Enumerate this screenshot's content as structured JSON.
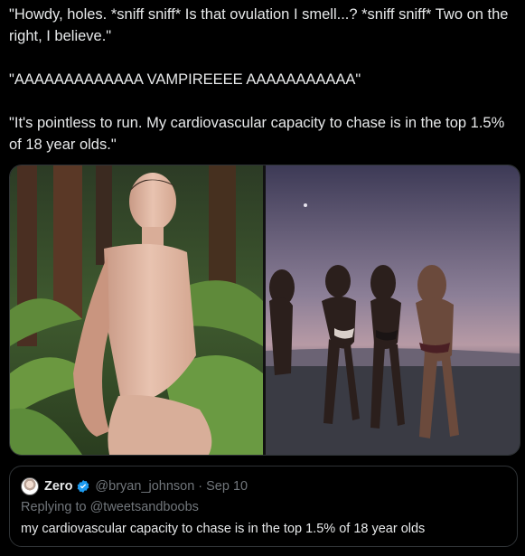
{
  "tweet": {
    "paragraphs": [
      "\"Howdy, holes. *sniff sniff* Is that ovulation I smell...? *sniff sniff* Two on the right, I believe.\"",
      "\"AAAAAAAAAAAAA VAMPIREEEE AAAAAAAAAAA\"",
      "\"It's pointless to run. My cardiovascular capacity to chase is in the top 1.5% of 18 year olds.\""
    ]
  },
  "media": {
    "left_image": "man-posing-in-ferns-photo",
    "right_image": "women-running-on-beach-at-dusk-photo"
  },
  "quote": {
    "display_name": "Zero",
    "verified": true,
    "handle": "@bryan_johnson",
    "separator": "·",
    "date": "Sep 10",
    "replying_to": "Replying to @tweetsandboobs",
    "text": "my cardiovascular capacity to chase is in the top 1.5% of 18 year olds"
  },
  "colors": {
    "background": "#000000",
    "text": "#e7e9ea",
    "muted": "#71767b",
    "border": "#2f3336",
    "verified": "#1d9bf0"
  }
}
